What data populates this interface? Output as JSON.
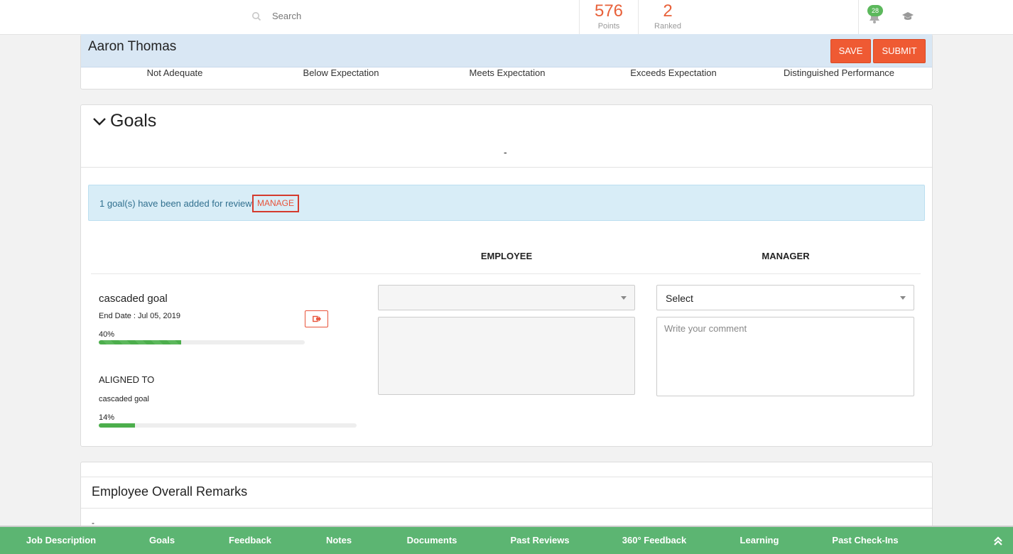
{
  "header": {
    "search_placeholder": "Search",
    "points_value": "576",
    "points_label": "Points",
    "ranked_value": "2",
    "ranked_label": "Ranked",
    "notification_count": "28"
  },
  "review": {
    "employee_name": "Aaron Thomas",
    "save_label": "SAVE",
    "submit_label": "SUBMIT",
    "rating_scale": [
      "Not Adequate",
      "Below Expectation",
      "Meets Expectation",
      "Exceeds Expectation",
      "Distinguished Performance"
    ]
  },
  "goals": {
    "title": "Goals",
    "subtitle": "-",
    "alert_text": "1 goal(s) have been added for review.",
    "manage_label": "MANAGE",
    "col_employee": "EMPLOYEE",
    "col_manager": "MANAGER",
    "goal_name": "cascaded goal",
    "end_date": "End Date : Jul 05, 2019",
    "progress_label": "40%",
    "progress_value": 40,
    "aligned_label": "ALIGNED TO",
    "aligned_goal_name": "cascaded goal",
    "aligned_progress_label": "14%",
    "aligned_progress_value": 14,
    "employee_select_value": "",
    "manager_select_value": "Select",
    "manager_comment_placeholder": "Write your comment"
  },
  "remarks": {
    "title": "Employee Overall Remarks",
    "value": "-"
  },
  "bottom_nav": [
    "Job Description",
    "Goals",
    "Feedback",
    "Notes",
    "Documents",
    "Past Reviews",
    "360° Feedback",
    "Learning",
    "Past Check-Ins"
  ],
  "colors": {
    "accent": "#ef5a33",
    "nav_green": "#5cb572",
    "progress_green": "#4cae4c",
    "alert_bg": "#d8edf7"
  }
}
